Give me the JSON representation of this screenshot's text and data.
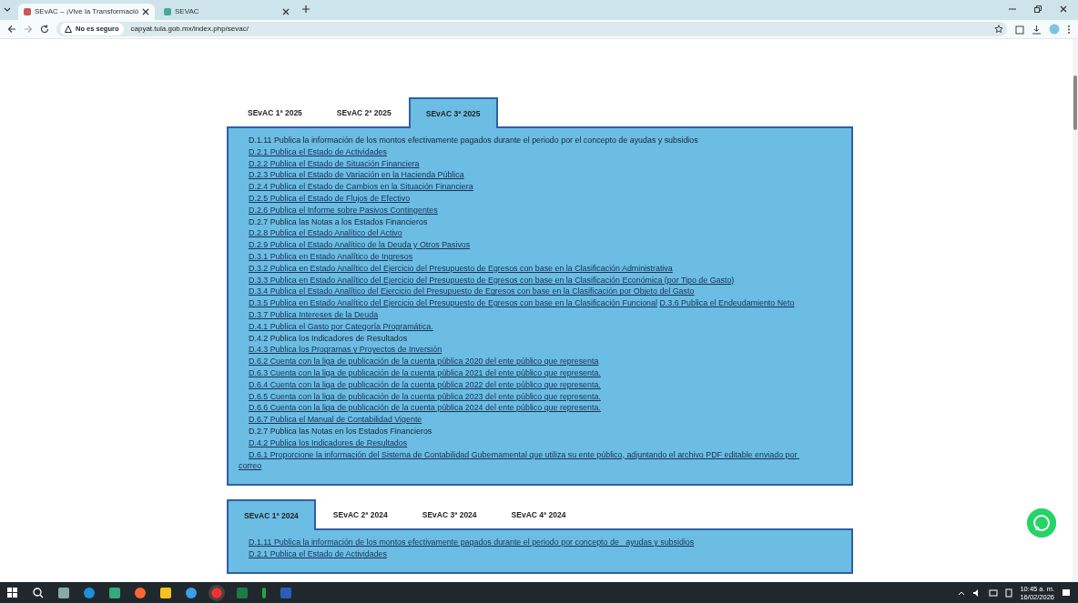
{
  "browser": {
    "tabs": [
      {
        "title": "SEvAC – ¡Vive la Transformació",
        "selected": true
      },
      {
        "title": "SEVAC",
        "selected": false
      }
    ],
    "security_label": "No es seguro",
    "url": "capyat.tula.gob.mx/index.php/sevac/"
  },
  "sections": [
    {
      "tabs": [
        {
          "label": "SEvAC 1ª 2025",
          "selected": false
        },
        {
          "label": "SEvAC 2ª 2025",
          "selected": false
        },
        {
          "label": "SEvAC 3ª 2025",
          "selected": true
        }
      ],
      "items": [
        {
          "text": "D.1.11 Publica la información de los montos efectivamente pagados durante el periodo por el concepto de ayudas y subsidios",
          "link": false
        },
        {
          "text": "D.2.1 Publica el Estado de Actividades",
          "link": true
        },
        {
          "text": "D.2.2 Publica el Estado de Situación Financiera",
          "link": true
        },
        {
          "text": "D.2.3 Publica el Estado de Variación en la Hacienda Pública",
          "link": true
        },
        {
          "text": "D.2.4 Publica el Estado de Cambios en la Situación Financiera",
          "link": true
        },
        {
          "text": "D.2.5 Publica el Estado de Flujos de Efectivo",
          "link": true
        },
        {
          "text": "D.2.6 Publica el Informe sobre Pasivos Contingentes",
          "link": true
        },
        {
          "text": "D.2.7 Publica las Notas a los Estados Financieros",
          "link": false
        },
        {
          "text": "D.2.8 Publica el Estado Analítico del Activo",
          "link": true
        },
        {
          "text": "D.2.9 Publica el Estado Analítico de la Deuda y Otros Pasivos",
          "link": true
        },
        {
          "text": "D.3.1 Publica en Estado Analítico de Ingresos",
          "link": true
        },
        {
          "text": "D.3.2 Publica en Estado Analítico del Ejercicio del Presupuesto de Egresos con base en la Clasificación Administrativa",
          "link": true
        },
        {
          "text": "D.3.3 Publica en Estado Analítico del Ejercicio del Presupuesto de Egresos con base en la Clasificación Económica (por Tipo de Gasto)",
          "link": true
        },
        {
          "text": "D.3.4 Publica el Estado Analítico del Ejercicio del Presupuesto de Egresos con base en la Clasificación por Objeto del Gasto",
          "link": true
        },
        {
          "text": "D.3.5 Publica en Estado Analítico del Ejercicio del Presupuesto de Egresos con base en la Clasificación Funcional",
          "link": true,
          "continuation": {
            "text": "D.3.6 Publica el Endeudamiento Neto",
            "link": true
          }
        },
        {
          "text": "D.3.7 Publica Intereses de la Deuda",
          "link": true
        },
        {
          "text": "D.4.1 Publica el Gasto por Categoría Programática.",
          "link": true
        },
        {
          "text": "D.4.2 Publica los Indicadores de Resultados",
          "link": false
        },
        {
          "text": "D.4.3 Publica los Programas y Proyectos de Inversión",
          "link": true
        },
        {
          "text": "D.6.2 Cuenta con la liga de publicación de la cuenta pública 2020 del ente público que representa",
          "link": true
        },
        {
          "text": "D.6.3 Cuenta con la liga de publicación de la cuenta pública 2021 del ente público que representa.",
          "link": true
        },
        {
          "text": "D.6.4 Cuenta con la liga de publicación de la cuenta pública 2022 del ente público que representa.",
          "link": true
        },
        {
          "text": "D.6.5 Cuenta con la liga de publicación de la cuenta pública 2023 del ente público que representa.",
          "link": true
        },
        {
          "text": "D.6.6 Cuenta con la liga de publicación de la cuenta pública 2024 del ente público que representa.",
          "link": true
        },
        {
          "text": "D.6.7 Publica el Manual de Contabilidad Vigente",
          "link": true
        },
        {
          "text": "D.2.7 Publica las Notas en los Estados Financieros",
          "link": false
        },
        {
          "text": "D.4.2 Publica los Indicadores de Resultados",
          "link": true
        },
        {
          "text": "D.6.1 Proporcione la información del Sistema de Contabilidad Gubernamental que utiliza su ente público, adjuntando el archivo PDF editable enviado por correo",
          "link": true
        }
      ]
    },
    {
      "tabs": [
        {
          "label": "SEvAC 1ª 2024",
          "selected": true
        },
        {
          "label": "SEvAC 2ª 2024",
          "selected": false
        },
        {
          "label": "SEvAC 3ª 2024",
          "selected": false
        },
        {
          "label": "SEvAC 4ª 2024",
          "selected": false
        }
      ],
      "items": [
        {
          "text": "D.1.11 Publica la información de los montos efectivamente pagados durante el periodo por concepto de   ayudas y subsidios",
          "link": true
        },
        {
          "text": "D.2.1 Publica el Estado de Actividades",
          "link": true
        }
      ]
    }
  ],
  "taskbar": {
    "time": "10:45 a. m.",
    "date": "16/02/2026"
  }
}
